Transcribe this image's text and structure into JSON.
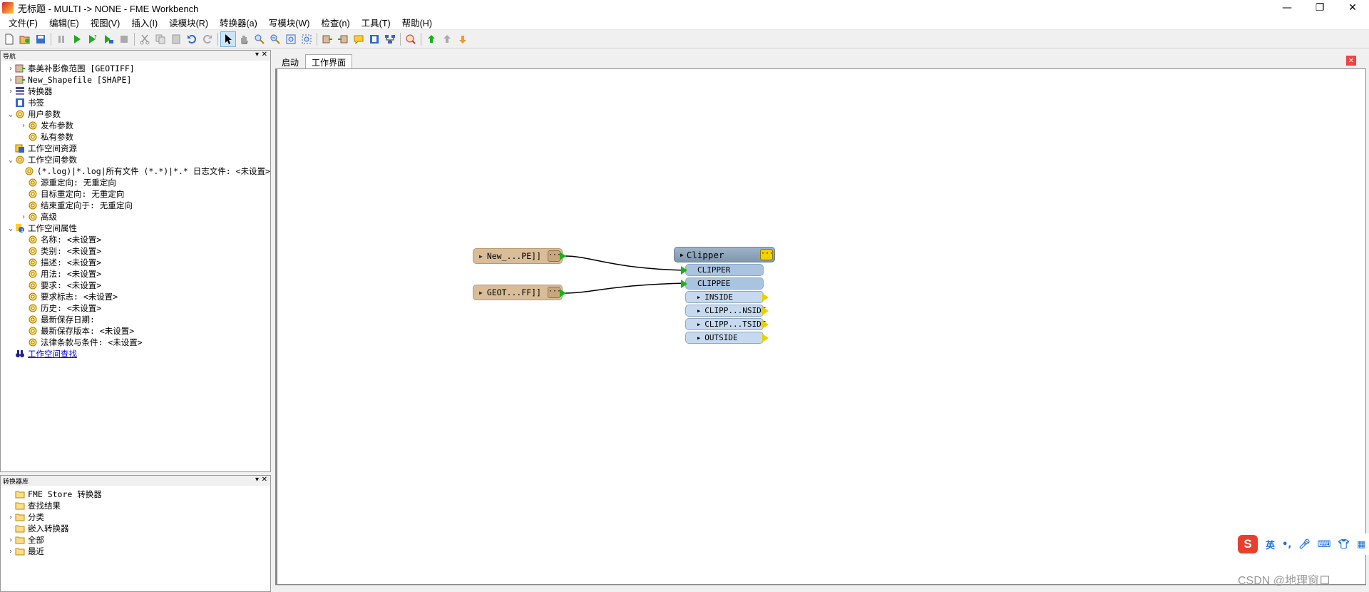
{
  "window": {
    "title": "无标题 - MULTI -> NONE - FME Workbench"
  },
  "menu": [
    "文件(F)",
    "编辑(E)",
    "视图(V)",
    "插入(I)",
    "读模块(R)",
    "转换器(a)",
    "写模块(W)",
    "检查(n)",
    "工具(T)",
    "帮助(H)"
  ],
  "nav": {
    "header": "导航",
    "items": [
      {
        "label": "泰美补影像范围 [GEOTIFF]",
        "level": 0,
        "exp": "›",
        "icon": "reader-icon"
      },
      {
        "label": "New_Shapefile [SHAPE]",
        "level": 0,
        "exp": "›",
        "icon": "reader-icon"
      },
      {
        "label": "转换器",
        "level": 0,
        "exp": "›",
        "icon": "transformer-list-icon"
      },
      {
        "label": "书签",
        "level": 0,
        "exp": "",
        "icon": "bookmark-icon"
      },
      {
        "label": "用户参数",
        "level": 0,
        "exp": "⌄",
        "icon": "gear-icon"
      },
      {
        "label": "发布参数",
        "level": 1,
        "exp": "›",
        "icon": "gear-icon"
      },
      {
        "label": "私有参数",
        "level": 1,
        "exp": "",
        "icon": "gear-icon"
      },
      {
        "label": "工作空间资源",
        "level": 0,
        "exp": "",
        "icon": "resource-icon"
      },
      {
        "label": "工作空间参数",
        "level": 0,
        "exp": "⌄",
        "icon": "gear-icon"
      },
      {
        "label": "(*.log)|*.log|所有文件 (*.*)|*.* 日志文件: <未设置>",
        "level": 1,
        "exp": "",
        "icon": "gear-icon"
      },
      {
        "label": "源重定向: 无重定向",
        "level": 1,
        "exp": "",
        "icon": "gear-icon"
      },
      {
        "label": "目标重定向: 无重定向",
        "level": 1,
        "exp": "",
        "icon": "gear-icon"
      },
      {
        "label": "结束重定向于: 无重定向",
        "level": 1,
        "exp": "",
        "icon": "gear-icon"
      },
      {
        "label": "高级",
        "level": 1,
        "exp": "›",
        "icon": "gear-icon"
      },
      {
        "label": "工作空间属性",
        "level": 0,
        "exp": "⌄",
        "icon": "info-icon"
      },
      {
        "label": "名称: <未设置>",
        "level": 1,
        "exp": "",
        "icon": "gear-icon"
      },
      {
        "label": "类别: <未设置>",
        "level": 1,
        "exp": "",
        "icon": "gear-icon"
      },
      {
        "label": "描述: <未设置>",
        "level": 1,
        "exp": "",
        "icon": "gear-icon"
      },
      {
        "label": "用法: <未设置>",
        "level": 1,
        "exp": "",
        "icon": "gear-icon"
      },
      {
        "label": "要求: <未设置>",
        "level": 1,
        "exp": "",
        "icon": "gear-icon"
      },
      {
        "label": "要求标志: <未设置>",
        "level": 1,
        "exp": "",
        "icon": "gear-icon"
      },
      {
        "label": "历史: <未设置>",
        "level": 1,
        "exp": "",
        "icon": "gear-icon"
      },
      {
        "label": "最新保存日期:",
        "level": 1,
        "exp": "",
        "icon": "gear-icon"
      },
      {
        "label": "最新保存版本: <未设置>",
        "level": 1,
        "exp": "",
        "icon": "gear-icon"
      },
      {
        "label": "法律条款与条件: <未设置>",
        "level": 1,
        "exp": "",
        "icon": "gear-icon"
      },
      {
        "label": "工作空间查找",
        "level": 0,
        "exp": "",
        "icon": "binoculars-icon",
        "link": true
      }
    ]
  },
  "gallery": {
    "header": "转换器库",
    "items": [
      {
        "label": "FME Store 转换器",
        "exp": ""
      },
      {
        "label": "查找结果",
        "exp": ""
      },
      {
        "label": "分类",
        "exp": "›"
      },
      {
        "label": "嵌入转换器",
        "exp": ""
      },
      {
        "label": "全部",
        "exp": "›"
      },
      {
        "label": "最近",
        "exp": "›"
      }
    ]
  },
  "tabs": [
    "启动",
    "工作界面"
  ],
  "canvas": {
    "readers": [
      "New_...PE]]",
      "GEOT...FF]]"
    ],
    "transformer": {
      "name": "Clipper",
      "inputs": [
        "CLIPPER",
        "CLIPPEE"
      ],
      "outputs": [
        "INSIDE",
        "CLIPP...NSIDE",
        "CLIPP...TSIDE",
        "OUTSIDE"
      ]
    }
  },
  "ime": {
    "logo": "S",
    "lang": "英"
  },
  "watermark": "CSDN @地理窗口",
  "colors": {
    "reader": "#d9bd98",
    "transformer": "#8ea4bb",
    "port": "#c6d9ee",
    "connection": "#000000"
  }
}
